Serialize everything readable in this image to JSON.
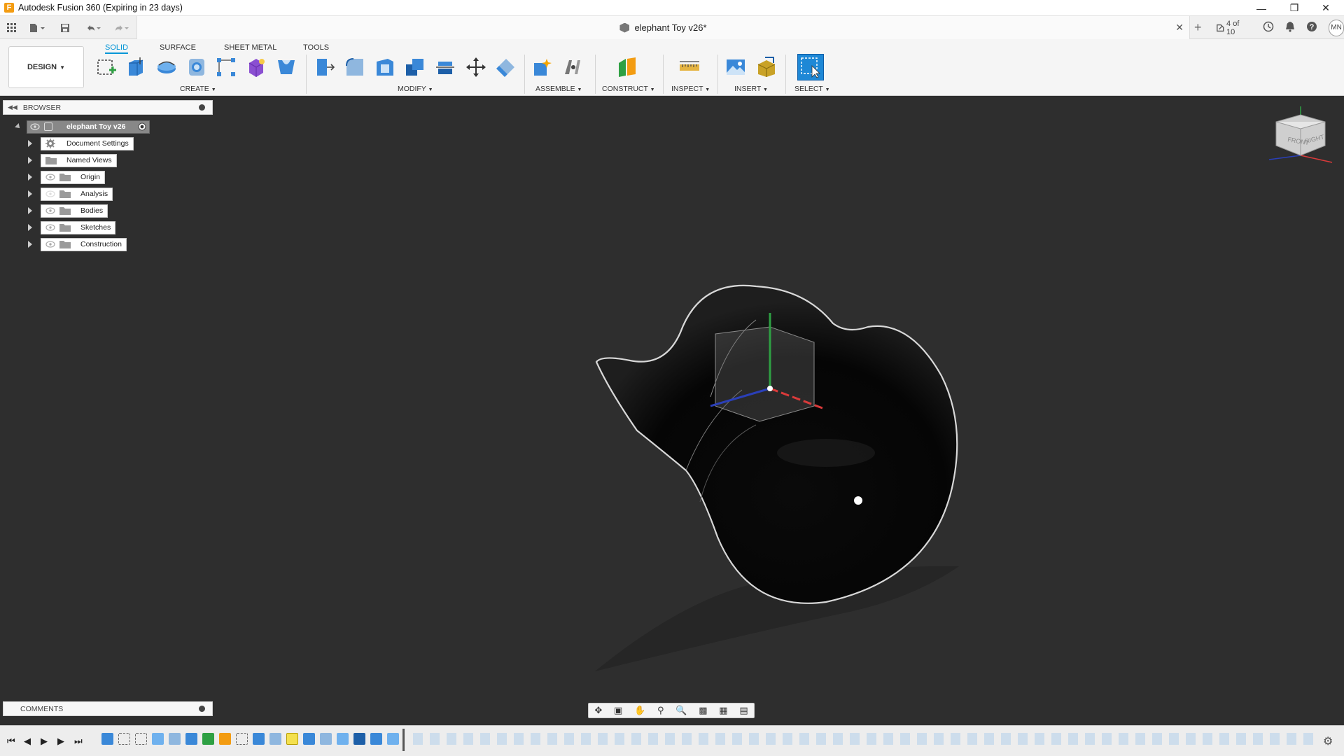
{
  "window": {
    "title": "Autodesk Fusion 360 (Expiring in 23 days)",
    "app_icon_letter": "F"
  },
  "appbar": {
    "document_tab_title": "elephant Toy v26*",
    "version_counter": "4 of 10",
    "user_initials": "MN"
  },
  "ribbon": {
    "tabs": [
      "SOLID",
      "SURFACE",
      "SHEET METAL",
      "TOOLS"
    ],
    "active_tab": "SOLID",
    "workspace_label": "DESIGN",
    "groups": [
      "CREATE",
      "MODIFY",
      "ASSEMBLE",
      "CONSTRUCT",
      "INSPECT",
      "INSERT",
      "SELECT"
    ]
  },
  "browser": {
    "header": "BROWSER",
    "root_label": "elephant Toy v26",
    "items": [
      {
        "label": "Document Settings",
        "icon": "gear-icon"
      },
      {
        "label": "Named Views",
        "icon": "folder-icon"
      },
      {
        "label": "Origin",
        "icon": "folder-icon"
      },
      {
        "label": "Analysis",
        "icon": "folder-icon"
      },
      {
        "label": "Bodies",
        "icon": "folder-icon"
      },
      {
        "label": "Sketches",
        "icon": "folder-icon"
      },
      {
        "label": "Construction",
        "icon": "folder-icon"
      }
    ]
  },
  "comments": {
    "label": "COMMENTS"
  },
  "viewcube": {
    "faces": [
      "FRONT",
      "RIGHT"
    ]
  },
  "colors": {
    "accent": "#0696d7",
    "viewport_bg": "#2e2e2e",
    "select_tool_bg": "#1e88d6"
  }
}
